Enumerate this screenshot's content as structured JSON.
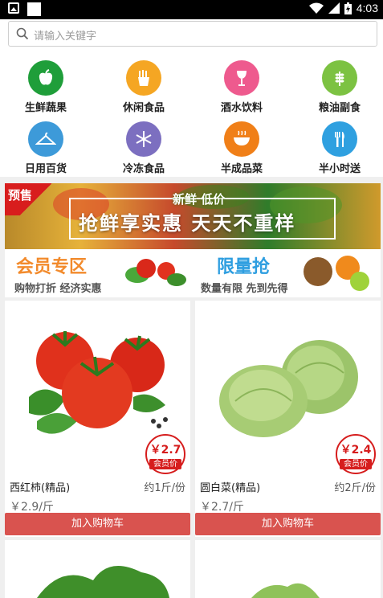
{
  "status_bar": {
    "time": "4:03"
  },
  "search": {
    "placeholder": "请输入关键字"
  },
  "categories": [
    {
      "label": "生鲜蔬果",
      "icon": "apple-icon",
      "color": "#1f9e3a"
    },
    {
      "label": "休闲食品",
      "icon": "fries-icon",
      "color": "#f5a623"
    },
    {
      "label": "酒水饮料",
      "icon": "wine-glass-icon",
      "color": "#ee5a8e"
    },
    {
      "label": "粮油副食",
      "icon": "wheat-icon",
      "color": "#7cc242"
    },
    {
      "label": "日用百货",
      "icon": "hanger-icon",
      "color": "#3d9ad9"
    },
    {
      "label": "冷冻食品",
      "icon": "snowflake-icon",
      "color": "#7c6fc0"
    },
    {
      "label": "半成品菜",
      "icon": "bowl-icon",
      "color": "#f07f18"
    },
    {
      "label": "半小时送",
      "icon": "fork-knife-icon",
      "color": "#2fa0e0"
    }
  ],
  "banner": {
    "tag": "预售",
    "subtitle": "新鲜  低价",
    "title": "抢鲜享实惠  天天不重样"
  },
  "promos": {
    "member": {
      "title": "会员专区",
      "subtitle": "购物打折 经济实惠",
      "color": "#f28a2b"
    },
    "limited": {
      "title": "限量抢",
      "subtitle": "数量有限  先到先得",
      "color": "#2e9ee0"
    }
  },
  "products": [
    {
      "name": "西红柿(精品)",
      "unit": "约1斤/份",
      "price": "￥2.9/斤",
      "member_price": "￥2.7",
      "member_label": "会员价",
      "button": "加入购物车"
    },
    {
      "name": "圆白菜(精品)",
      "unit": "约2斤/份",
      "price": "￥2.7/斤",
      "member_price": "￥2.4",
      "member_label": "会员价",
      "button": "加入购物车"
    }
  ],
  "colors": {
    "accent_red": "#d61d1d",
    "button_red": "#d9534f"
  }
}
